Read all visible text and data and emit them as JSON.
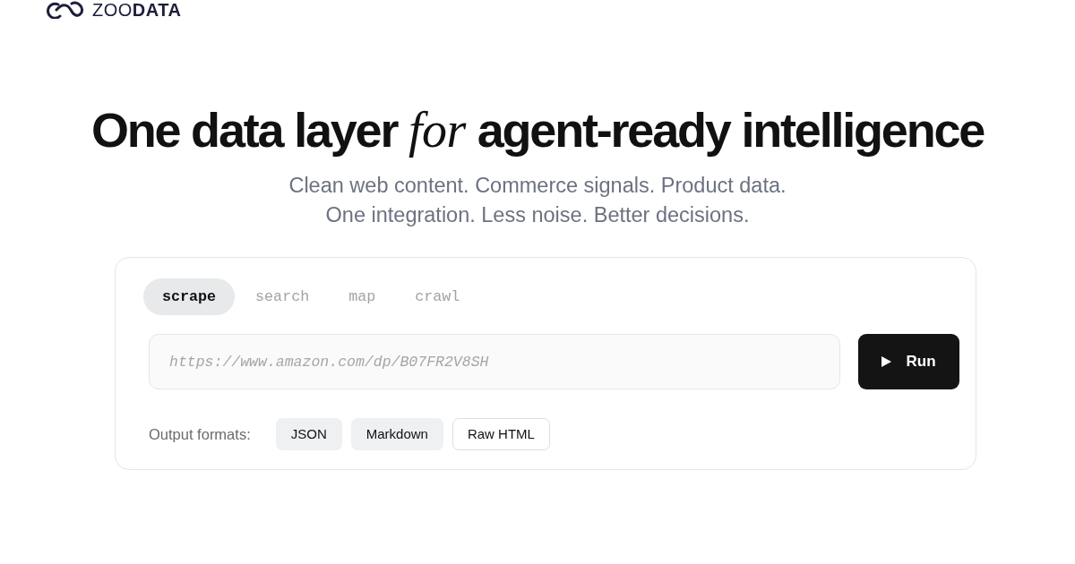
{
  "brand": {
    "name": "ZOO**DATA**"
  },
  "hero": {
    "title": "One data layer *for* agent-ready intelligence",
    "subtitle_lines": [
      "Clean web content. Commerce signals. Product data.",
      "One integration. Less noise. Better decisions."
    ]
  },
  "tabs": [
    {
      "label": "scrape",
      "selected": true
    },
    {
      "label": "search",
      "selected": false
    },
    {
      "label": "map",
      "selected": false
    },
    {
      "label": "crawl",
      "selected": false
    }
  ],
  "url_field": {
    "placeholder": "https://www.amazon.com/dp/B07FR2V8SH"
  },
  "run_button": {
    "label": "Run"
  },
  "output_formats": {
    "label": "Output formats:",
    "options": [
      {
        "label": "JSON",
        "selected": true
      },
      {
        "label": "Markdown",
        "selected": true
      },
      {
        "label": "Raw HTML",
        "selected": false
      }
    ]
  }
}
